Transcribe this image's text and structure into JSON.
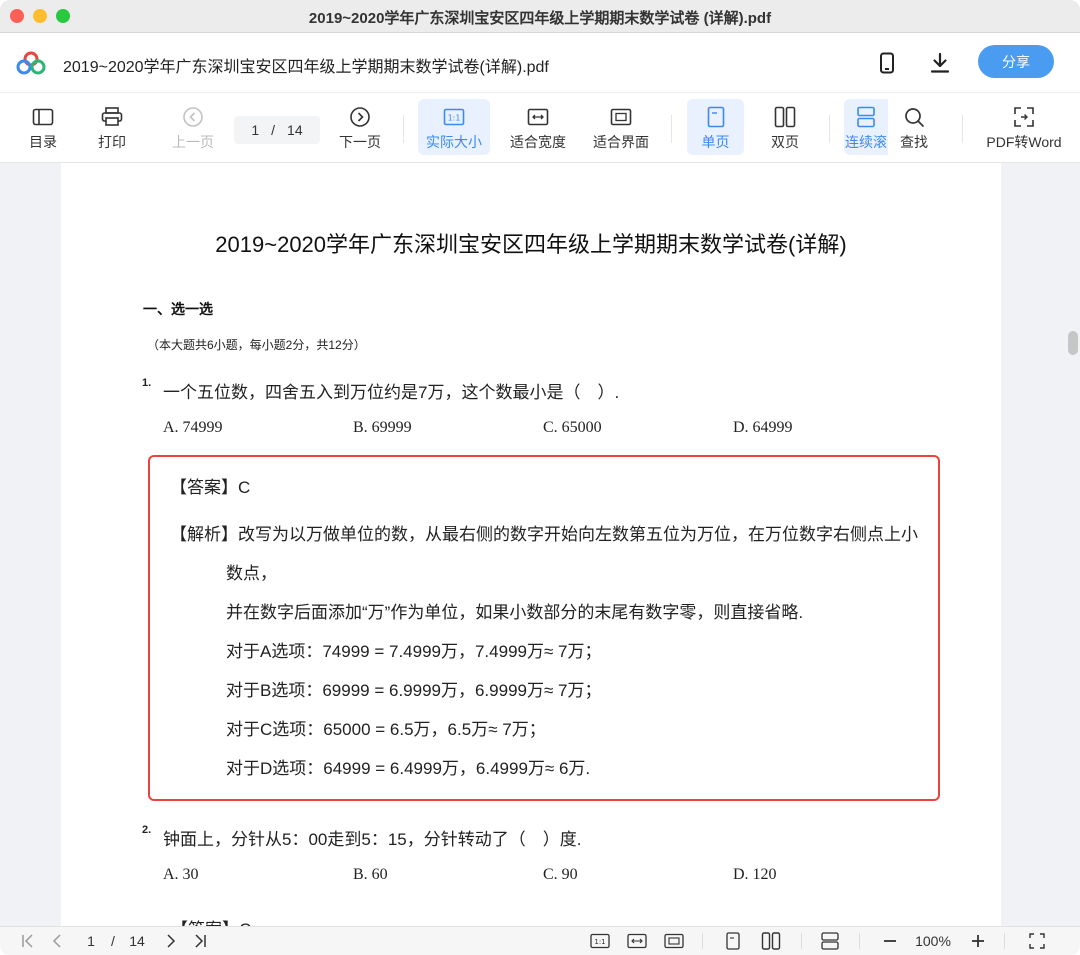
{
  "window": {
    "title": "2019~2020学年广东深圳宝安区四年级上学期期末数学试卷 (详解).pdf"
  },
  "header": {
    "doc_title": "2019~2020学年广东深圳宝安区四年级上学期期末数学试卷(详解).pdf",
    "share_label": "分享",
    "accent": "#4a9cf0"
  },
  "toolbar": {
    "toc": "目录",
    "print": "打印",
    "prev_page": "上一页",
    "current_page": "1",
    "page_sep": "/",
    "total_pages": "14",
    "next_page": "下一页",
    "actual_size": "实际大小",
    "fit_width": "适合宽度",
    "fit_page": "适合界面",
    "single_page": "单页",
    "double_page": "双页",
    "continuous": "连续滚",
    "find": "查找",
    "pdf_to_word": "PDF转Word"
  },
  "document": {
    "title": "2019~2020学年广东深圳宝安区四年级上学期期末数学试卷(详解)",
    "section_title": "一、选一选",
    "section_note": "（本大题共6小题，每小题2分，共12分）",
    "q1": {
      "num": "1.",
      "text": "一个五位数，四舍五入到万位约是7万，这个数最小是（　）.",
      "options": [
        "A. 74999",
        "B. 69999",
        "C. 65000",
        "D. 64999"
      ]
    },
    "answer1": {
      "answer_tag": "【答案】",
      "answer_value": "C",
      "analysis_tag": "【解析】",
      "analysis_line1": "改写为以万做单位的数，从最右侧的数字开始向左数第五位为万位，在万位数字右侧点上小",
      "analysis_line2": "数点，",
      "analysis_line3": "并在数字后面添加“万”作为单位，如果小数部分的末尾有数字零，则直接省略.",
      "lineA": "对于A选项：74999 = 7.4999万，7.4999万≈ 7万；",
      "lineB": "对于B选项：69999 = 6.9999万，6.9999万≈ 7万；",
      "lineC": "对于C选项：65000 = 6.5万，6.5万≈ 7万；",
      "lineD": "对于D选项：64999 = 6.4999万，6.4999万≈ 6万."
    },
    "q2": {
      "num": "2.",
      "text": "钟面上，分针从5：00走到5：15，分针转动了（　）度.",
      "options": [
        "A. 30",
        "B. 60",
        "C. 90",
        "D. 120"
      ]
    },
    "answer2_partial": "【答案】C",
    "highlight_color": "#e8453c"
  },
  "bottombar": {
    "current_page": "1",
    "page_sep": "/",
    "total_pages": "14",
    "zoom": "100%"
  }
}
